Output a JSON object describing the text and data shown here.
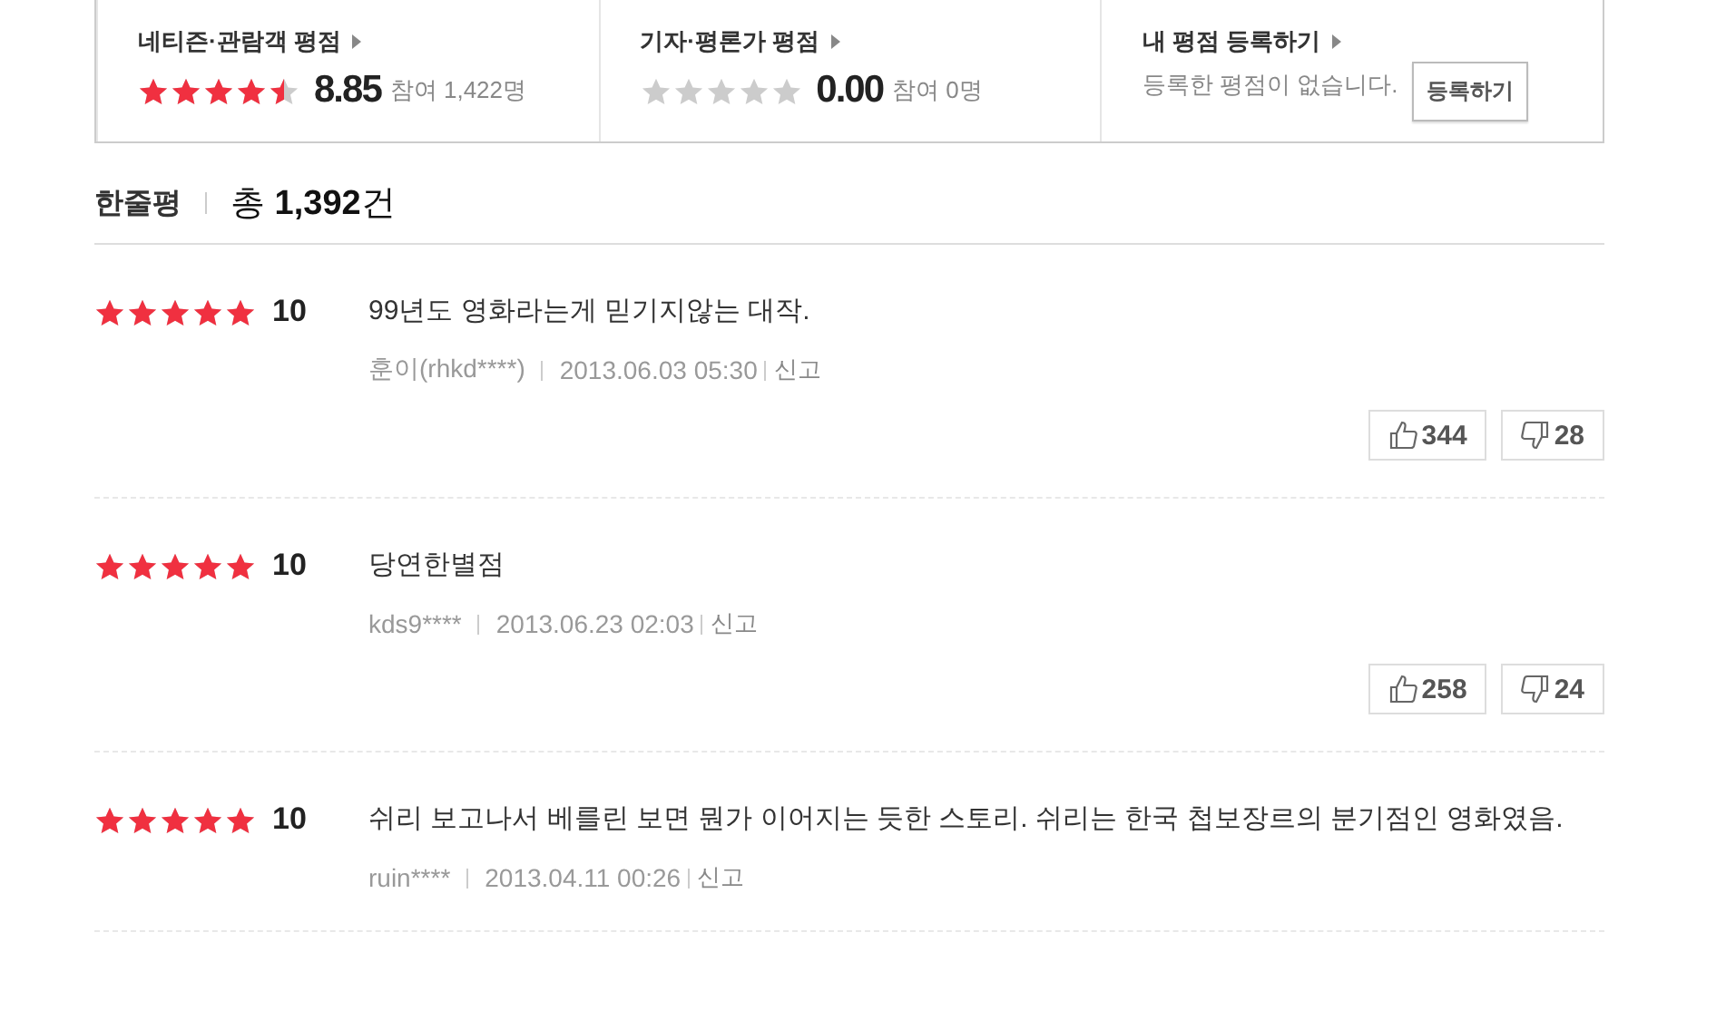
{
  "ratings": [
    {
      "kind": "score",
      "title": "네티즌·관람객 평점",
      "stars": 4.5,
      "score": "8.85",
      "participants": "참여 1,422명"
    },
    {
      "kind": "score",
      "title": "기자·평론가 평점",
      "stars": 0,
      "score": "0.00",
      "participants": "참여 0명"
    },
    {
      "kind": "register",
      "title": "내 평점 등록하기",
      "message": "등록한 평점이 없습니다.",
      "button": "등록하기"
    }
  ],
  "section": {
    "title": "한줄평",
    "total_prefix": "총",
    "total": "1,392",
    "total_suffix": "건"
  },
  "reviews": [
    {
      "stars": 5,
      "score": "10",
      "text": "99년도 영화라는게 믿기지않는 대작.",
      "author": "훈이(rhkd****)",
      "date": "2013.06.03 05:30",
      "report": "신고",
      "likes": "344",
      "dislikes": "28"
    },
    {
      "stars": 5,
      "score": "10",
      "text": "당연한별점",
      "author": "kds9****",
      "date": "2013.06.23 02:03",
      "report": "신고",
      "likes": "258",
      "dislikes": "24"
    },
    {
      "stars": 5,
      "score": "10",
      "text": "쉬리 보고나서 베를린 보면 뭔가 이어지는 듯한 스토리. 쉬리는 한국 첩보장르의 분기점인 영화였음.",
      "author": "ruin****",
      "date": "2013.04.11 00:26",
      "report": "신고"
    }
  ]
}
